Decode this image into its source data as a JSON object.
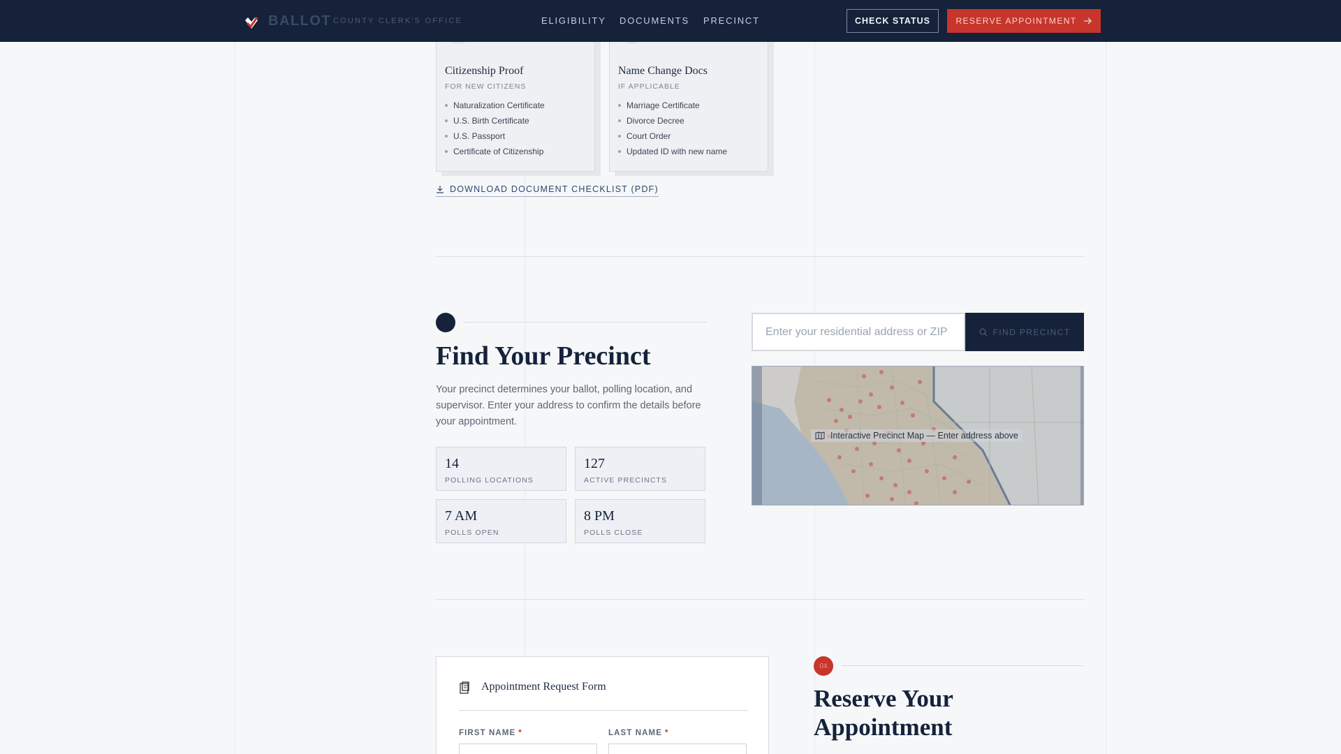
{
  "header": {
    "brand": "BALLOT",
    "brand_sub": "COUNTY CLERK'S OFFICE",
    "nav": [
      "ELIGIBILITY",
      "DOCUMENTS",
      "PRECINCT"
    ],
    "check_status": "CHECK STATUS",
    "reserve": "RESERVE APPOINTMENT"
  },
  "documents": {
    "cards": [
      {
        "title": "Citizenship Proof",
        "subtitle": "FOR NEW CITIZENS",
        "items": [
          "Naturalization Certificate",
          "U.S. Birth Certificate",
          "U.S. Passport",
          "Certificate of Citizenship"
        ]
      },
      {
        "title": "Name Change Docs",
        "subtitle": "IF APPLICABLE",
        "items": [
          "Marriage Certificate",
          "Divorce Decree",
          "Court Order",
          "Updated ID with new name"
        ]
      }
    ],
    "download_label": "DOWNLOAD DOCUMENT CHECKLIST (PDF)"
  },
  "precinct": {
    "title": "Find Your Precinct",
    "description": "Your precinct determines your ballot, polling location, and supervisor. Enter your address to confirm the details before your appointment.",
    "stats": [
      {
        "value": "14",
        "label": "POLLING LOCATIONS"
      },
      {
        "value": "127",
        "label": "ACTIVE PRECINCTS"
      },
      {
        "value": "7 AM",
        "label": "POLLS OPEN"
      },
      {
        "value": "8 PM",
        "label": "POLLS CLOSE"
      }
    ],
    "search_placeholder": "Enter your residential address or ZIP",
    "find_button": "FIND PRECINCT",
    "map_caption": "Interactive Precinct Map — Enter address above"
  },
  "appointment": {
    "form_title": "Appointment Request Form",
    "first_name_label": "FIRST NAME",
    "last_name_label": "LAST NAME",
    "required_mark": "*",
    "step_number": "04",
    "section_title": "Reserve Your Appointment"
  },
  "colors": {
    "navy": "#15223a",
    "accent_red": "#c7352b",
    "background": "#f6f7f9"
  }
}
